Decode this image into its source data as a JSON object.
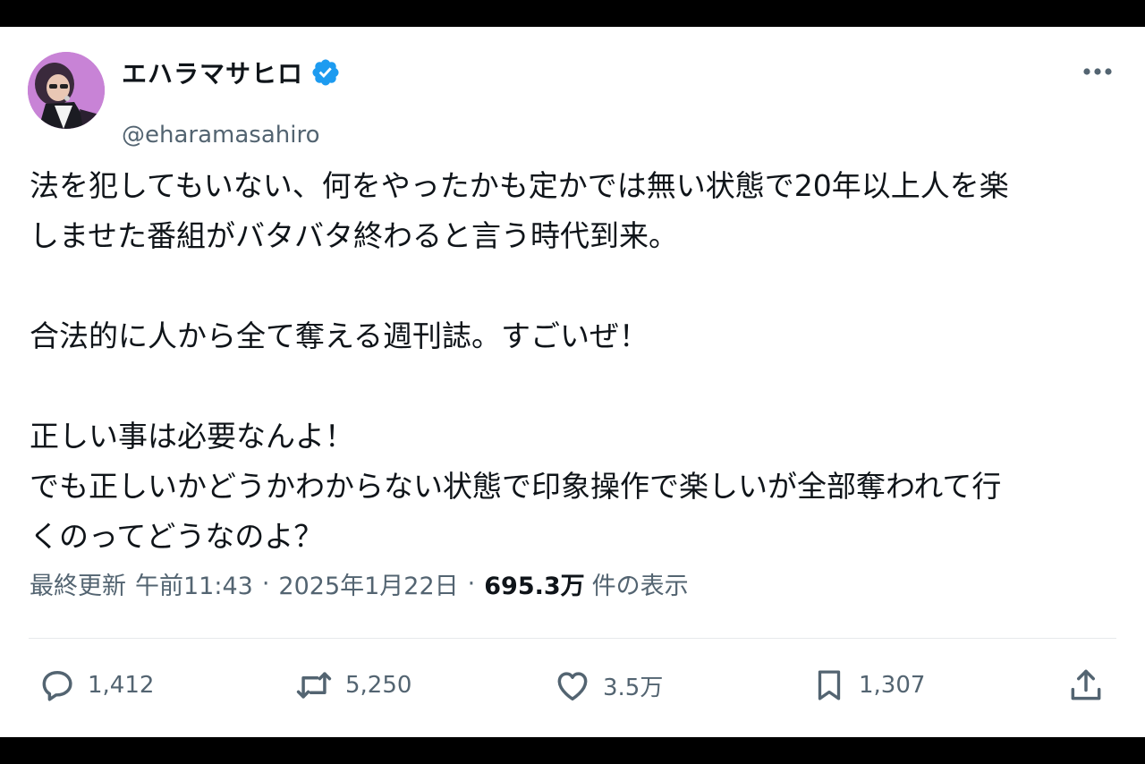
{
  "tweet": {
    "author": {
      "display_name": "エハラマサヒロ",
      "handle": "@eharamasahiro",
      "verified": true
    },
    "text": {
      "line1": "法を犯してもいない、何をやったかも定かでは無い状態で20年以上人を楽",
      "line2": "しませた番組がバタバタ終わると言う時代到来。",
      "line3": "合法的に人から全て奪える週刊誌。すごいぜ！",
      "line4": "正しい事は必要なんよ！",
      "line5": "でも正しいかどうかわからない状態で印象操作で楽しいが全部奪われて行",
      "line6": "くのってどうなのよ？"
    },
    "meta": {
      "updated_label": "最終更新",
      "time": "午前11:43",
      "separator": "·",
      "date": "2025年1月22日",
      "views_count": "695.3万",
      "views_label": "件の表示"
    },
    "actions": {
      "replies": "1,412",
      "reposts": "5,250",
      "likes": "3.5万",
      "bookmarks": "1,307"
    }
  },
  "icons": {
    "more": "more-icon",
    "verified": "verified-badge-icon",
    "reply": "reply-icon",
    "repost": "repost-icon",
    "like": "heart-icon",
    "bookmark": "bookmark-icon",
    "share": "share-icon"
  },
  "colors": {
    "verified_blue": "#1d9bf0",
    "text": "#0f1419",
    "muted": "#536471"
  }
}
